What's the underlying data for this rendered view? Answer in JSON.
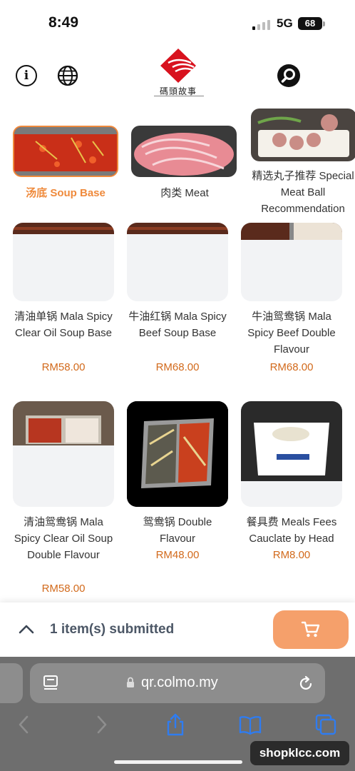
{
  "status_bar": {
    "time": "8:49",
    "network": "5G",
    "battery": "68"
  },
  "header": {
    "logo_text": "碼頭故事"
  },
  "categories": [
    {
      "label": "汤底 Soup Base",
      "active": true
    },
    {
      "label": "肉类 Meat",
      "active": false
    },
    {
      "label": "精选丸子推荐 Special Meat Ball Recommendation",
      "active": false
    }
  ],
  "products": [
    {
      "name": "清油单锅 Mala Spicy Clear Oil Soup Base",
      "price": "RM58.00"
    },
    {
      "name": "牛油红锅 Mala Spicy Beef Soup Base",
      "price": "RM68.00"
    },
    {
      "name": "牛油鸳鸯锅 Mala Spicy Beef Double Flavour",
      "price": "RM68.00"
    },
    {
      "name": "清油鸳鸯锅 Mala Spicy Clear Oil Soup Double Flavour",
      "price": "RM58.00"
    },
    {
      "name": "鸳鸯锅 Double Flavour",
      "price": "RM48.00"
    },
    {
      "name": "餐具费 Meals Fees Cauclate by Head",
      "price": "RM8.00"
    }
  ],
  "cart_bar": {
    "submitted_text": "1 item(s) submitted"
  },
  "browser": {
    "url": "qr.colmo.my"
  },
  "watermark": "shopklcc.com",
  "colors": {
    "accent": "#ef8a3c",
    "price": "#d26a1c",
    "cart_button": "#f5a06b"
  }
}
